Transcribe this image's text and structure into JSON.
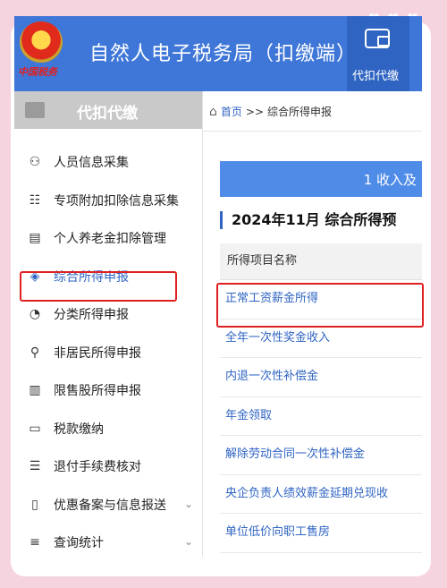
{
  "header": {
    "emblem_text": "中国税务",
    "app_title": "自然人电子税务局（扣缴端）",
    "top_tab_label": "代扣代缴",
    "top_tab_icon": "wallet-icon"
  },
  "sidebar": {
    "section_title": "代扣代缴",
    "items": [
      {
        "label": "人员信息采集",
        "icon": "person-icon",
        "glyph": "⚇"
      },
      {
        "label": "专项附加扣除信息采集",
        "icon": "list-icon",
        "glyph": "☷"
      },
      {
        "label": "个人养老金扣除管理",
        "icon": "document-icon",
        "glyph": "▤"
      },
      {
        "label": "综合所得申报",
        "icon": "layers-icon",
        "glyph": "◈"
      },
      {
        "label": "分类所得申报",
        "icon": "pie-chart-icon",
        "glyph": "◔"
      },
      {
        "label": "非居民所得申报",
        "icon": "user-icon",
        "glyph": "⚲"
      },
      {
        "label": "限售股所得申报",
        "icon": "bar-chart-icon",
        "glyph": "▥"
      },
      {
        "label": "税款缴纳",
        "icon": "folder-icon",
        "glyph": "▭"
      },
      {
        "label": "退付手续费核对",
        "icon": "checklist-icon",
        "glyph": "☰"
      },
      {
        "label": "优惠备案与信息报送",
        "icon": "file-icon",
        "glyph": "▯"
      },
      {
        "label": "查询统计",
        "icon": "search-list-icon",
        "glyph": "≡"
      }
    ]
  },
  "breadcrumb": {
    "home": "首页",
    "separator": ">>",
    "current": "综合所得申报"
  },
  "main": {
    "step_label": "1 收入及",
    "period_title": "2024年11月  综合所得预",
    "table_header": "所得项目名称",
    "rows": [
      "正常工资薪金所得",
      "全年一次性奖金收入",
      "内退一次性补偿金",
      "年金领取",
      "解除劳动合同一次性补偿金",
      "央企负责人绩效薪金延期兑现收",
      "单位低价向职工售房"
    ]
  },
  "colors": {
    "brand_blue": "#3f77d8",
    "highlight_red": "#e02020",
    "background_pink": "#f6d4df"
  }
}
